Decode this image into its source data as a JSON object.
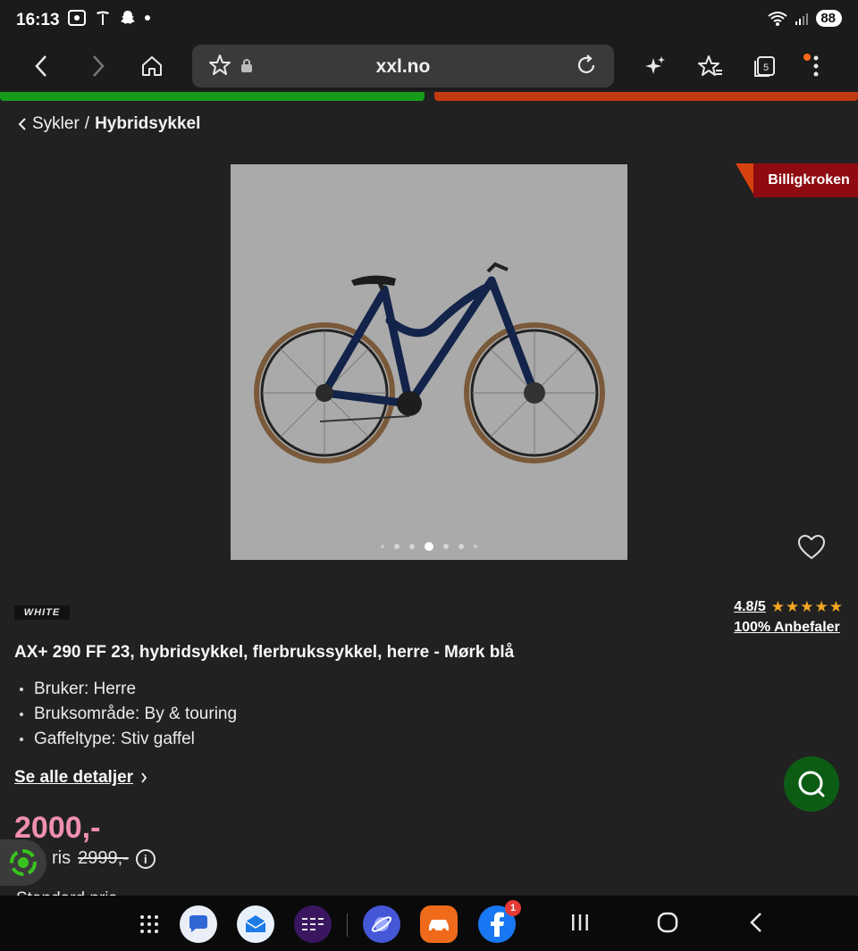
{
  "status_bar": {
    "time": "16:13",
    "battery": "88"
  },
  "browser": {
    "url": "xxl.no",
    "tabs_count": "5"
  },
  "breadcrumb": {
    "parent": "Sykler",
    "separator": "/",
    "current": "Hybridsykkel"
  },
  "badge": {
    "label": "Billigkroken"
  },
  "gallery": {
    "total_images": 7,
    "active_index": 3
  },
  "brand": {
    "name": "WHITE"
  },
  "rating": {
    "score": "4.8/5",
    "stars": "★★★★★",
    "recommend": "100% Anbefaler"
  },
  "product": {
    "title": "AX+ 290 FF 23, hybridsykkel, flerbrukssykkel, herre - Mørk blå",
    "specs": [
      "Bruker: Herre",
      "Bruksområde: By & touring",
      "Gaffeltype: Stiv gaffel"
    ],
    "details_link": "Se alle detaljer",
    "price": "2000,-",
    "old_price_prefix": "ris",
    "old_price": "2999,-",
    "cutoff_text": "Standard pris"
  },
  "taskbar": {
    "facebook_badge": "1"
  },
  "colors": {
    "price": "#f08fb0",
    "badge_bg": "#8e0b12",
    "strip_green": "#169c1a",
    "strip_red": "#c23a10",
    "chat_fab": "#0d5c14"
  }
}
